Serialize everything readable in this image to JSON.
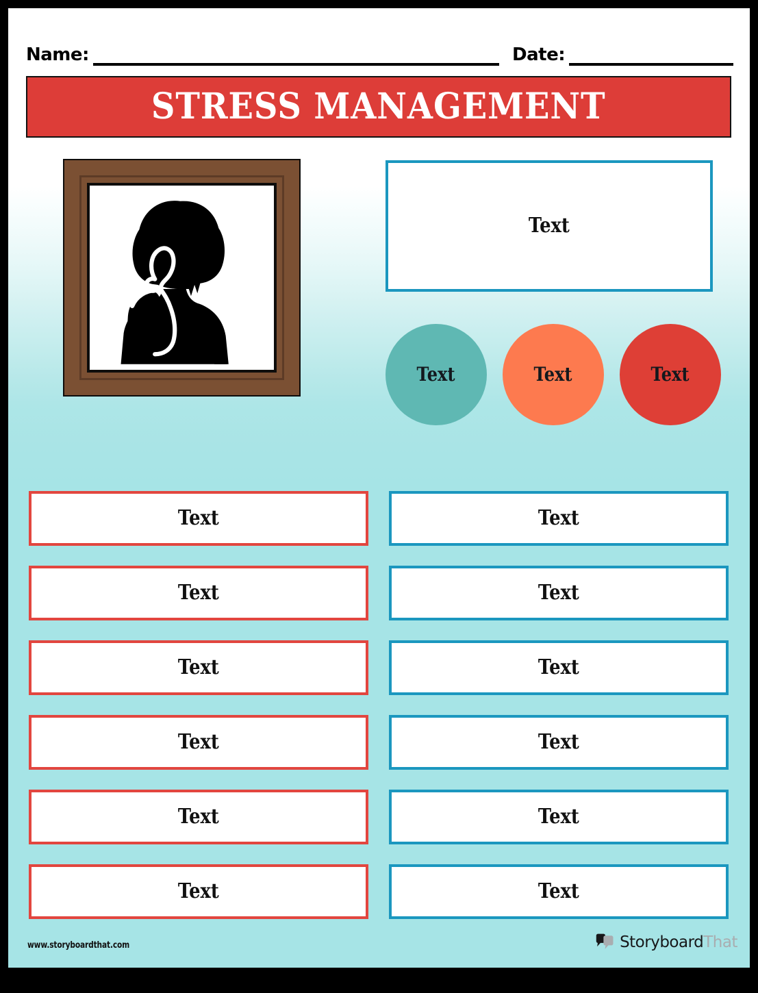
{
  "header": {
    "name_label": "Name:",
    "date_label": "Date:"
  },
  "title": {
    "text": "STRESS MANAGEMENT",
    "banner_color": "#dd3d38",
    "text_color": "#ffffff"
  },
  "illustration": {
    "frame_color": "#7b5033",
    "frame_inner_color": "#5d3b26",
    "subject": "person-silhouette-stressed",
    "mat_color": "#ffffff"
  },
  "top_textbox": {
    "text": "Text",
    "border_color": "#1b97bf"
  },
  "circles": [
    {
      "text": "Text",
      "color": "#5fb8b3"
    },
    {
      "text": "Text",
      "color": "#fd7a4f"
    },
    {
      "text": "Text",
      "color": "#de3f36"
    }
  ],
  "grid": {
    "rows": [
      {
        "left": {
          "text": "Text",
          "border_color": "#e2463f"
        },
        "right": {
          "text": "Text",
          "border_color": "#1b97bf"
        }
      },
      {
        "left": {
          "text": "Text",
          "border_color": "#e2463f"
        },
        "right": {
          "text": "Text",
          "border_color": "#1b97bf"
        }
      },
      {
        "left": {
          "text": "Text",
          "border_color": "#e2463f"
        },
        "right": {
          "text": "Text",
          "border_color": "#1b97bf"
        }
      },
      {
        "left": {
          "text": "Text",
          "border_color": "#e2463f"
        },
        "right": {
          "text": "Text",
          "border_color": "#1b97bf"
        }
      },
      {
        "left": {
          "text": "Text",
          "border_color": "#e2463f"
        },
        "right": {
          "text": "Text",
          "border_color": "#1b97bf"
        }
      },
      {
        "left": {
          "text": "Text",
          "border_color": "#e2463f"
        },
        "right": {
          "text": "Text",
          "border_color": "#1b97bf"
        }
      }
    ]
  },
  "footer": {
    "url": "www.storyboardthat.com",
    "logo_primary": "Storyboard",
    "logo_secondary": "That"
  },
  "theme": {
    "background_top": "#ffffff",
    "background_bottom": "#a6e4e6",
    "red": "#dd3d38",
    "teal_border": "#1b97bf",
    "page_border": "#000000"
  }
}
